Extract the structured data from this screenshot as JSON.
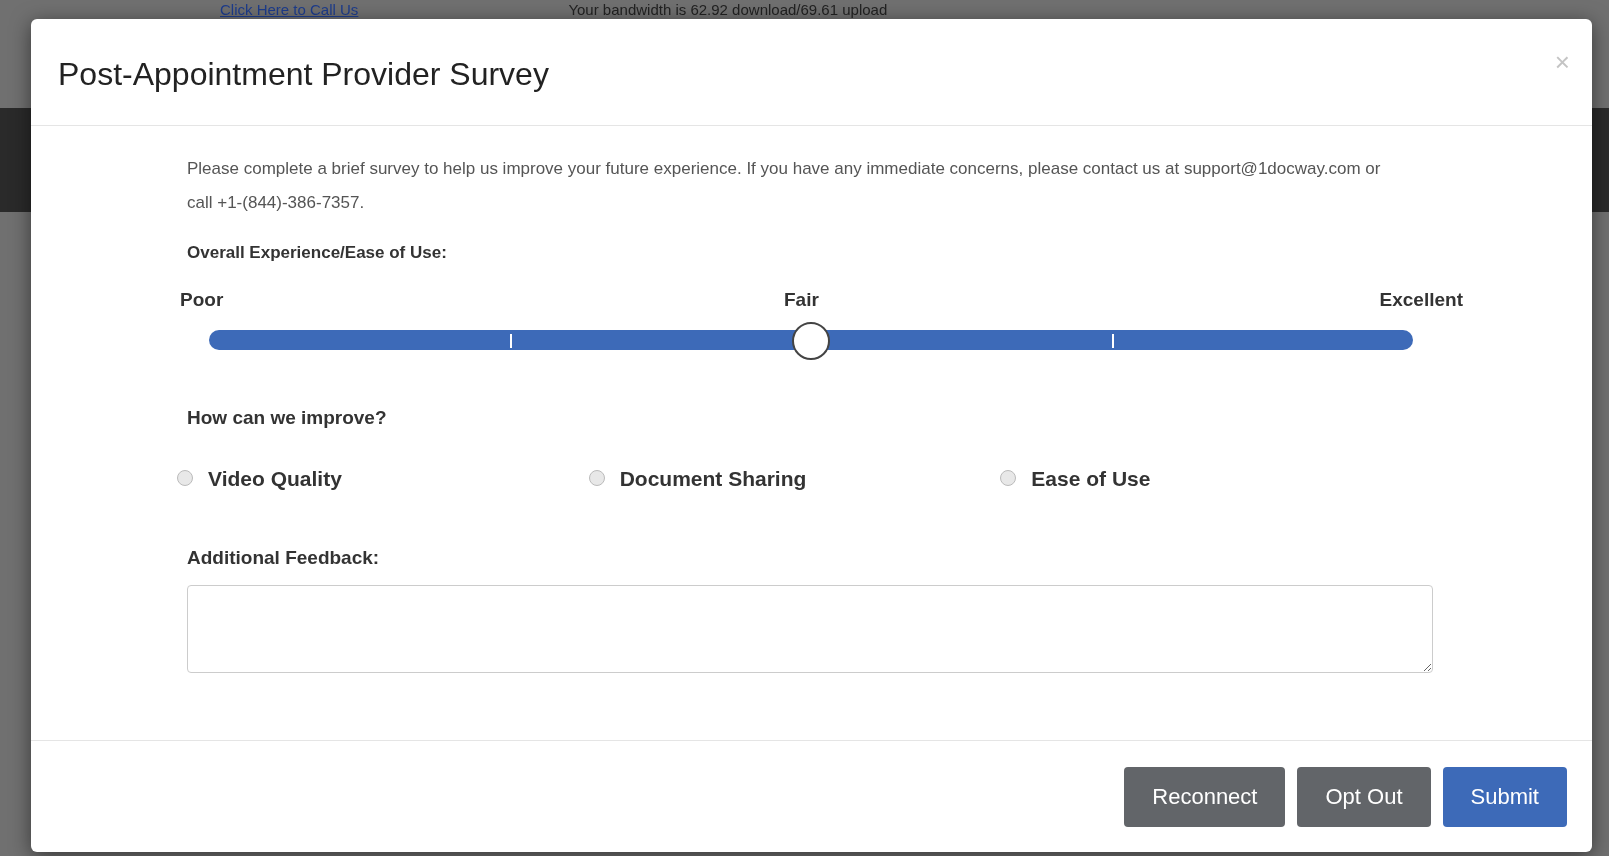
{
  "background": {
    "link": "Click Here to Call Us",
    "bandwidth": "Your bandwidth is 62.92 download/69.61 upload"
  },
  "dialog": {
    "title": "Post-Appointment Provider Survey",
    "close": "×",
    "intro": "Please complete a brief survey to help us improve your future experience. If you have any immediate concerns, please contact us at support@1docway.com or call +1-(844)-386-7357.",
    "rating": {
      "label": "Overall Experience/Ease of Use:",
      "scale": [
        "Poor",
        "Fair",
        "Excellent"
      ],
      "level": 0.5
    },
    "improve": {
      "label": "How can we improve?",
      "options": [
        {
          "label": "Video Quality",
          "selected": false
        },
        {
          "label": "Document Sharing",
          "selected": false
        },
        {
          "label": "Ease of Use",
          "selected": false
        }
      ]
    },
    "feedback": {
      "label": "Additional Feedback:"
    },
    "buttons": [
      {
        "label": "Reconnect",
        "kind": "secondary"
      },
      {
        "label": "Opt Out",
        "kind": "secondary"
      },
      {
        "label": "Submit",
        "kind": "primary"
      }
    ]
  }
}
